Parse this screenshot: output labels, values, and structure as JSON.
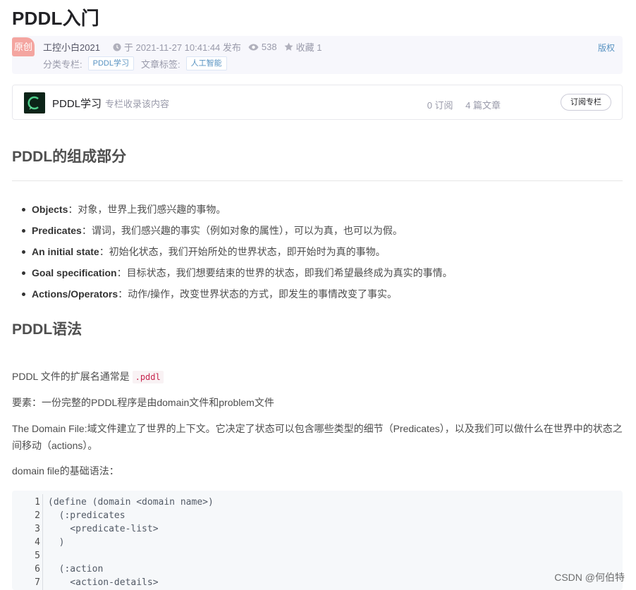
{
  "article": {
    "title": "PDDL入门",
    "original_badge": "原创",
    "author": "工控小白2021",
    "publish_time": "于 2021-11-27 10:41:44 发布",
    "views": "538",
    "favorites": "收藏 1",
    "copyright": "版权",
    "category_label": "分类专栏:",
    "category_tag": "PDDL学习",
    "article_tags_label": "文章标签:",
    "article_tag": "人工智能"
  },
  "column": {
    "name": "PDDL学习",
    "desc": "专栏收录该内容",
    "subscriptions": "0 订阅",
    "articles": "4 篇文章",
    "subscribe_button": "订阅专栏"
  },
  "content": {
    "h2_components": "PDDL的组成部分",
    "components": [
      {
        "term": "Objects",
        "desc": "：对象，世界上我们感兴趣的事物。"
      },
      {
        "term": "Predicates",
        "desc": "：谓词，我们感兴趣的事实（例如对象的属性），可以为真，也可以为假。"
      },
      {
        "term": "An initial state",
        "desc": "：初始化状态，我们开始所处的世界状态，即开始时为真的事物。"
      },
      {
        "term": "Goal specification",
        "desc": "：目标状态，我们想要结束的世界的状态，即我们希望最终成为真实的事情。"
      },
      {
        "term": "Actions/Operators",
        "desc": "：动作/操作，改变世界状态的方式，即发生的事情改变了事实。"
      }
    ],
    "h2_syntax": "PDDL语法",
    "p1_text": "PDDL 文件的扩展名通常是 ",
    "p1_code": ".pddl",
    "p2": "要素：一份完整的PDDL程序是由domain文件和problem文件",
    "p3": "The Domain File:域文件建立了世界的上下文。它决定了状态可以包含哪些类型的细节（Predicates），以及我们可以做什么在世界中的状态之间移动（actions）。",
    "p4": "domain file的基础语法："
  },
  "code_block": {
    "line_numbers": [
      "1",
      "2",
      "3",
      "4",
      "5",
      "6",
      "7"
    ],
    "lines": [
      "(define (domain <domain name>)",
      "  (:predicates",
      "    <predicate-list>",
      "  )",
      "",
      "  (:action",
      "    <action-details>"
    ]
  },
  "watermark": "CSDN @何伯特",
  "colors": {
    "badge": "#f4a5a0",
    "link": "#5893c2",
    "meta_bg": "#f7f7fc",
    "code_bg": "#f6f8fa",
    "inline_code": "#c7254e"
  }
}
